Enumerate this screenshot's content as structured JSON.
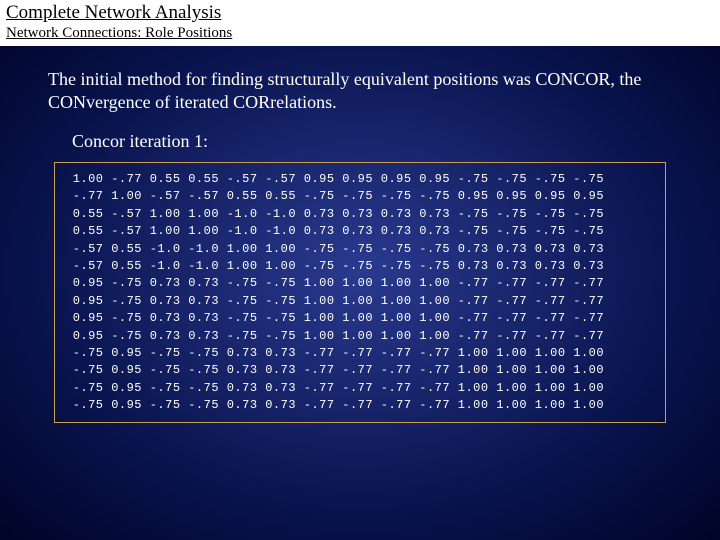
{
  "header": {
    "title": "Complete Network Analysis",
    "subtitle": "Network Connections: Role Positions"
  },
  "intro": "The initial method for finding structurally equivalent positions was CONCOR, the CONvergence of iterated CORrelations.",
  "iteration_label": "Concor iteration 1:",
  "matrix_text": " 1.00 -.77 0.55 0.55 -.57 -.57 0.95 0.95 0.95 0.95 -.75 -.75 -.75 -.75\n -.77 1.00 -.57 -.57 0.55 0.55 -.75 -.75 -.75 -.75 0.95 0.95 0.95 0.95\n 0.55 -.57 1.00 1.00 -1.0 -1.0 0.73 0.73 0.73 0.73 -.75 -.75 -.75 -.75\n 0.55 -.57 1.00 1.00 -1.0 -1.0 0.73 0.73 0.73 0.73 -.75 -.75 -.75 -.75\n -.57 0.55 -1.0 -1.0 1.00 1.00 -.75 -.75 -.75 -.75 0.73 0.73 0.73 0.73\n -.57 0.55 -1.0 -1.0 1.00 1.00 -.75 -.75 -.75 -.75 0.73 0.73 0.73 0.73\n 0.95 -.75 0.73 0.73 -.75 -.75 1.00 1.00 1.00 1.00 -.77 -.77 -.77 -.77\n 0.95 -.75 0.73 0.73 -.75 -.75 1.00 1.00 1.00 1.00 -.77 -.77 -.77 -.77\n 0.95 -.75 0.73 0.73 -.75 -.75 1.00 1.00 1.00 1.00 -.77 -.77 -.77 -.77\n 0.95 -.75 0.73 0.73 -.75 -.75 1.00 1.00 1.00 1.00 -.77 -.77 -.77 -.77\n -.75 0.95 -.75 -.75 0.73 0.73 -.77 -.77 -.77 -.77 1.00 1.00 1.00 1.00\n -.75 0.95 -.75 -.75 0.73 0.73 -.77 -.77 -.77 -.77 1.00 1.00 1.00 1.00\n -.75 0.95 -.75 -.75 0.73 0.73 -.77 -.77 -.77 -.77 1.00 1.00 1.00 1.00\n -.75 0.95 -.75 -.75 0.73 0.73 -.77 -.77 -.77 -.77 1.00 1.00 1.00 1.00"
}
